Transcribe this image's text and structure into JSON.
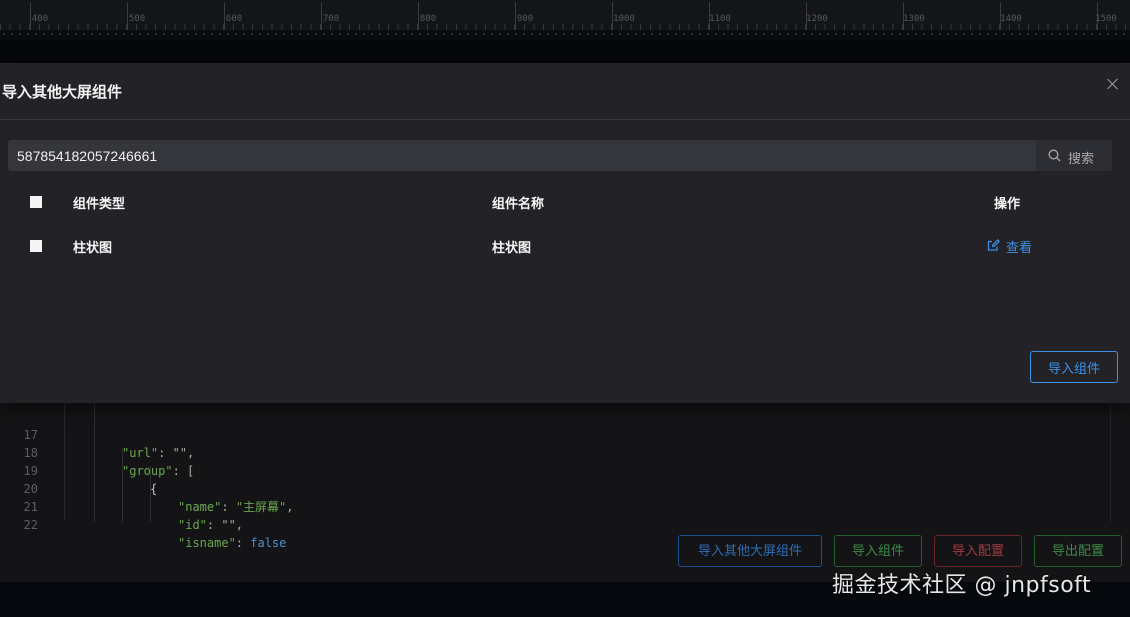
{
  "ruler": {
    "labels": [
      "400",
      "500",
      "600",
      "700",
      "800",
      "900",
      "1000",
      "1100",
      "1200",
      "1300",
      "1400",
      "1500"
    ]
  },
  "modal": {
    "title": "导入其他大屏组件",
    "search": {
      "value": "587854182057246661",
      "button_label": "搜索"
    },
    "table": {
      "headers": {
        "type": "组件类型",
        "name": "组件名称",
        "action": "操作"
      },
      "rows": [
        {
          "type": "柱状图",
          "name": "柱状图",
          "action_label": "查看"
        }
      ]
    },
    "import_button": "导入组件"
  },
  "editor": {
    "lines": [
      {
        "num": "17",
        "key": "\"url\"",
        "rest": ": \"\","
      },
      {
        "num": "18",
        "key": "\"group\"",
        "rest": ": ["
      },
      {
        "num": "19",
        "text": "{"
      },
      {
        "num": "20",
        "key": "\"name\"",
        "value": "\"主屏幕\"",
        "tail": ","
      },
      {
        "num": "21",
        "key": "\"id\"",
        "rest": ": \"\","
      },
      {
        "num": "22",
        "key": "\"isname\"",
        "bool": "false"
      }
    ],
    "buttons": {
      "import_other": "导入其他大屏组件",
      "import_component": "导入组件",
      "import_config": "导入配置",
      "export_config": "导出配置"
    }
  },
  "watermark": "掘金技术社区 @ jnpfsoft",
  "colors": {
    "accent_blue": "#3f8fe6",
    "modal_bg": "#232327",
    "code_key_green": "#6aa84f",
    "code_bool_blue": "#4f8fd1"
  }
}
